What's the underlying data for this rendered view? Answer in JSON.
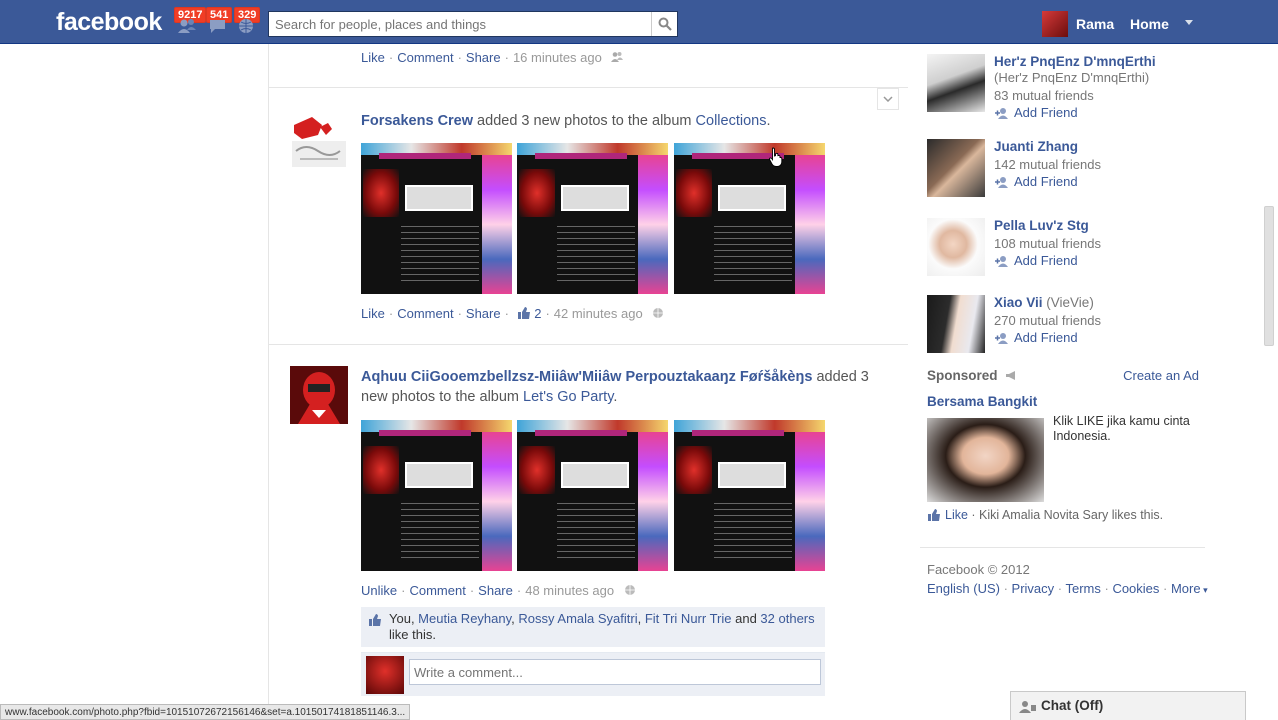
{
  "topbar": {
    "logo": "facebook",
    "badges": {
      "friend_requests": "9217",
      "messages": "541",
      "notifications": "329"
    },
    "search_placeholder": "Search for people, places and things",
    "user_name": "Rama",
    "home": "Home"
  },
  "prev_story": {
    "like": "Like",
    "comment": "Comment",
    "share": "Share",
    "time": "16 minutes ago"
  },
  "story1": {
    "actor": "Forsakens Crew",
    "verb": " added 3 new photos to the album ",
    "album": "Collections",
    "period": ".",
    "like": "Like",
    "comment": "Comment",
    "share": "Share",
    "like_count": "2",
    "time": "42 minutes ago"
  },
  "story2": {
    "actor": "Aqhuu CiiGooemzbellzsz-Miiâw'Miiâw Perpouztakaaŋz Føŕšåkèŋs",
    "verb": " added 3 new photos to the album ",
    "album": "Let's Go Party",
    "period": ".",
    "unlike": "Unlike",
    "comment": "Comment",
    "share": "Share",
    "time": "48 minutes ago",
    "likes": {
      "you": "You, ",
      "p1": "Meutia Reyhany",
      "comma1": ", ",
      "p2": "Rossy Amala Syafitri",
      "comma2": ", ",
      "p3": "Fit Tri Nurr Trie",
      "and": " and ",
      "others": "32 others",
      "tail": " like this."
    },
    "comment_placeholder": "Write a comment..."
  },
  "people": [
    {
      "name": "Her'z PnqEnz D'mnqErthi",
      "alt": "(Her'z PnqEnz D'mnqErthi)",
      "mutual": "83 mutual friends",
      "add": "Add Friend"
    },
    {
      "name": "Juanti Zhang",
      "alt": "",
      "mutual": "142 mutual friends",
      "add": "Add Friend"
    },
    {
      "name": "Pella Luv'z Stg",
      "alt": "",
      "mutual": "108 mutual friends",
      "add": "Add Friend"
    },
    {
      "name": "Xiao Vii",
      "alt": " (VieVie)",
      "mutual": "270 mutual friends",
      "add": "Add Friend"
    }
  ],
  "sponsored": {
    "label": "Sponsored",
    "create_ad": "Create an Ad",
    "title": "Bersama Bangkit",
    "text": "Klik LIKE jika kamu cinta Indonesia.",
    "like": "Like",
    "like_text": " · Kiki Amalia Novita Sary likes this."
  },
  "footer": {
    "copyright": "Facebook © 2012",
    "english": "English (US)",
    "privacy": "Privacy",
    "terms": "Terms",
    "cookies": "Cookies",
    "more": "More"
  },
  "chat": {
    "label": "Chat (Off)"
  },
  "status_url": "www.facebook.com/photo.php?fbid=10151072672156146&set=a.10150174181851146.3...",
  "colors": {
    "brand": "#3b5998",
    "badge": "#f03d25",
    "link": "#3b5998"
  }
}
